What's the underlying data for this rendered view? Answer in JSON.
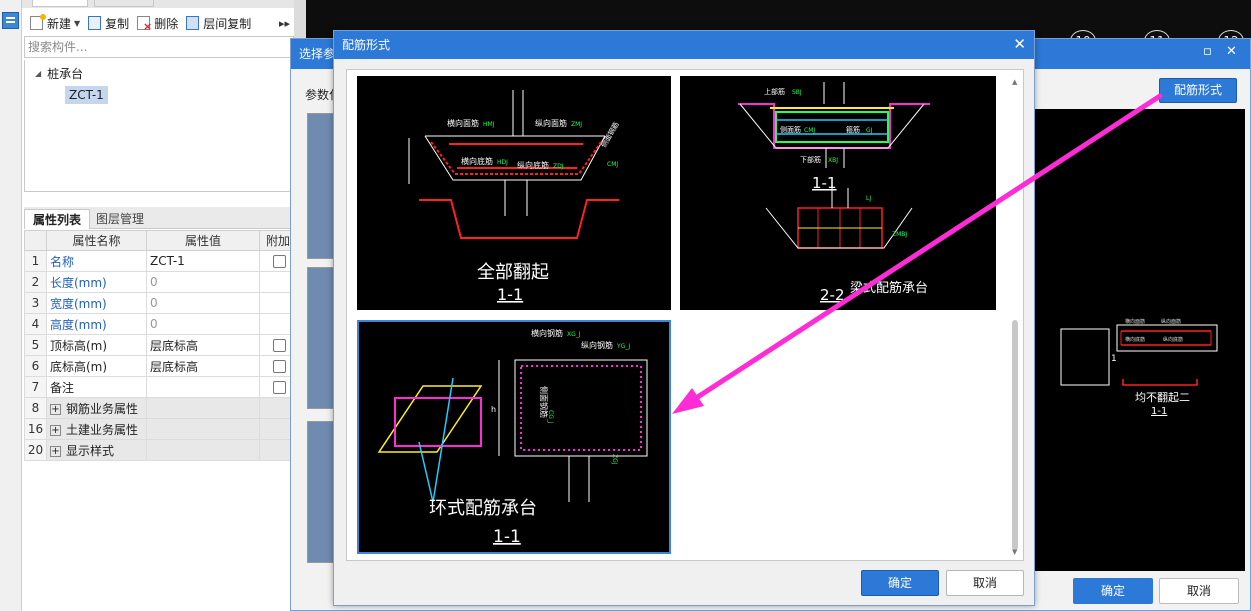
{
  "colors": {
    "accent": "#2c79d7",
    "arrow": "#ff2bd6",
    "cad_bg": "#000000"
  },
  "left_panel": {
    "toolbar": {
      "new": "新建",
      "copy": "复制",
      "delete": "删除",
      "layer_copy": "层间复制",
      "more_icon": "chevron-double-right-icon"
    },
    "search_placeholder": "搜索构件...",
    "tree": {
      "category": "桩承台",
      "item": "ZCT-1"
    },
    "tabs": {
      "props": "属性列表",
      "layers": "图层管理"
    },
    "table": {
      "headers": [
        "属性名称",
        "属性值",
        "附加"
      ],
      "rows": [
        {
          "num": "1",
          "name": "名称",
          "value": "ZCT-1"
        },
        {
          "num": "2",
          "name": "长度(mm)",
          "value": "0"
        },
        {
          "num": "3",
          "name": "宽度(mm)",
          "value": "0"
        },
        {
          "num": "4",
          "name": "高度(mm)",
          "value": "0"
        },
        {
          "num": "5",
          "name": "顶标高(m)",
          "value": "层底标高"
        },
        {
          "num": "6",
          "name": "底标高(m)",
          "value": "层底标高"
        },
        {
          "num": "7",
          "name": "备注",
          "value": ""
        },
        {
          "num": "8",
          "name": "钢筋业务属性",
          "value": ""
        },
        {
          "num": "16",
          "name": "土建业务属性",
          "value": ""
        },
        {
          "num": "20",
          "name": "显示样式",
          "value": ""
        }
      ]
    }
  },
  "back_dialog": {
    "title": "选择参",
    "label": "参数化",
    "peijin_button": "配筋形式",
    "ok": "确定",
    "cancel": "取消",
    "axis_numbers": [
      "10",
      "11",
      "12"
    ],
    "preview": {
      "caption": "均不翻起二",
      "section": "1-1",
      "labels": [
        "横向面筋",
        "纵向面筋",
        "横向底筋",
        "纵向底筋"
      ],
      "dim": "1"
    }
  },
  "front_dialog": {
    "title": "配筋形式",
    "ok": "确定",
    "cancel": "取消",
    "cards": [
      {
        "caption": "全部翻起",
        "section": "1-1",
        "labels": {
          "hmj": "横向面筋",
          "hmj_code": "HMJ",
          "zmj": "纵向面筋",
          "zmj_code": "ZMJ",
          "hdj": "横向底筋",
          "hdj_code": "HDJ",
          "zdj": "纵向底筋",
          "zdj_code": "ZDJ",
          "cmj": "CMJ",
          "side": "侧面钢筋"
        }
      },
      {
        "caption": "梁式配筋承台",
        "section1": "1-1",
        "section2": "2-2",
        "labels": {
          "top": "上部筋",
          "top_code": "SBJ",
          "mid": "侧面筋",
          "mid_code": "CMJ",
          "bot": "下部筋",
          "bot_code": "XBJ",
          "stirrup": "箍筋",
          "stirrup_code": "GJ",
          "lj": "LJ",
          "zmbj": "ZMBJ"
        }
      },
      {
        "caption": "环式配筋承台",
        "section": "1-1",
        "labels": {
          "hor": "横向钢筋",
          "hor_code": "XG_J",
          "ver": "纵向钢筋",
          "ver_code": "YG_J",
          "side": "侧面钢筋",
          "side_code": "CG_J",
          "h": "h",
          "bottom_code": "ZGJ"
        }
      }
    ]
  }
}
